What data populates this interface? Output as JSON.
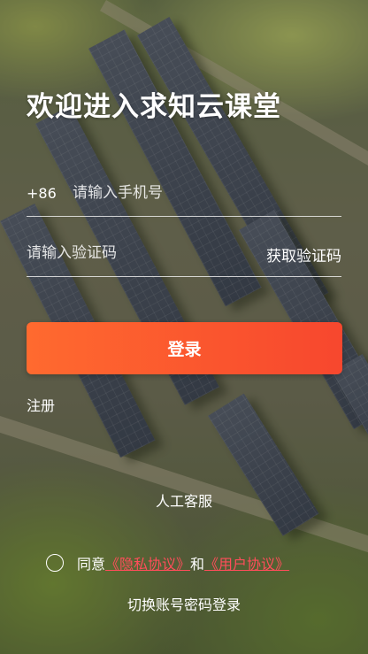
{
  "header": {
    "title": "欢迎进入求知云课堂"
  },
  "phone": {
    "country_code": "+86",
    "placeholder": "请输入手机号",
    "value": ""
  },
  "verify": {
    "placeholder": "请输入验证码",
    "value": "",
    "get_code_label": "获取验证码"
  },
  "login_button": {
    "label": "登录"
  },
  "register_link": {
    "label": "注册"
  },
  "customer_service": {
    "label": "人工客服"
  },
  "agreement": {
    "prefix": "同意",
    "privacy_link": "《隐私协议》",
    "conjunction": "和",
    "user_link": "《用户协议》",
    "checked": false
  },
  "switch_login": {
    "label": "切换账号密码登录"
  },
  "colors": {
    "accent_start": "#ff6a2f",
    "accent_end": "#f7472e",
    "link": "#ff4d5a"
  }
}
